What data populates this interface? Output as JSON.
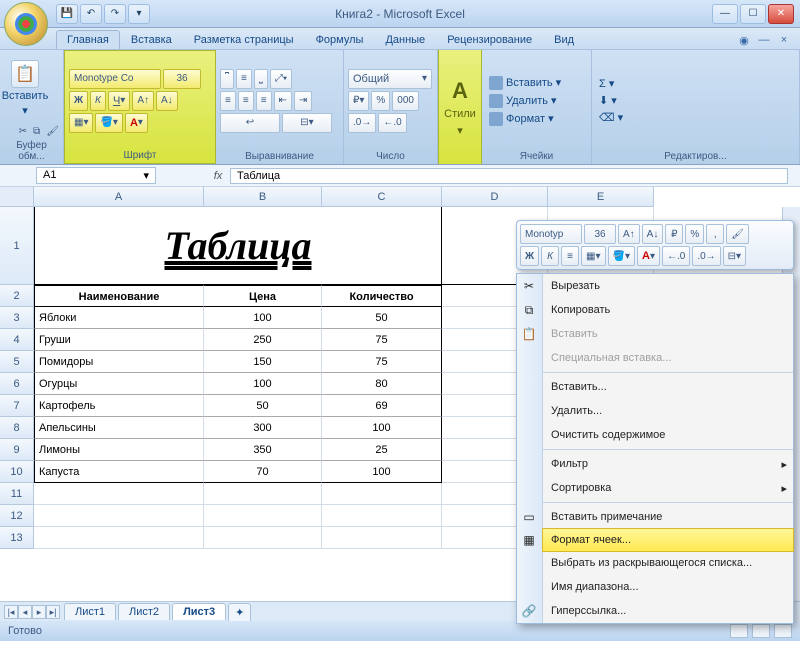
{
  "title": "Книга2 - Microsoft Excel",
  "qat": {
    "save": "💾",
    "undo": "↶",
    "redo": "↷"
  },
  "tabs": [
    "Главная",
    "Вставка",
    "Разметка страницы",
    "Формулы",
    "Данные",
    "Рецензирование",
    "Вид"
  ],
  "ribbon": {
    "paste": {
      "label": "Вставить"
    },
    "clipboard_label": "Буфер обм...",
    "font": {
      "family": "Monotype Co",
      "size": "36",
      "bold": "Ж",
      "italic": "К",
      "underline": "Ч",
      "label": "Шрифт"
    },
    "align_label": "Выравнивание",
    "number": {
      "format": "Общий",
      "label": "Число"
    },
    "styles_label": "Стили",
    "cells": {
      "insert": "Вставить",
      "delete": "Удалить",
      "format": "Формат",
      "label": "Ячейки"
    },
    "editing_label": "Редактиров..."
  },
  "namebox": "A1",
  "formula": "Таблица",
  "cols": [
    "A",
    "B",
    "C",
    "D",
    "E"
  ],
  "table": {
    "title": "Таблица",
    "headers": [
      "Наименование",
      "Цена",
      "Количество"
    ],
    "rows": [
      [
        "Яблоки",
        "100",
        "50"
      ],
      [
        "Груши",
        "250",
        "75"
      ],
      [
        "Помидоры",
        "150",
        "75"
      ],
      [
        "Огурцы",
        "100",
        "80"
      ],
      [
        "Картофель",
        "50",
        "69"
      ],
      [
        "Апельсины",
        "300",
        "100"
      ],
      [
        "Лимоны",
        "350",
        "25"
      ],
      [
        "Капуста",
        "70",
        "100"
      ]
    ]
  },
  "sheet_tabs": [
    "Лист1",
    "Лист2",
    "Лист3"
  ],
  "active_sheet": "Лист3",
  "status": "Готово",
  "minitool": {
    "font": "Monotyp",
    "size": "36",
    "bold": "Ж",
    "italic": "К"
  },
  "ctx": [
    {
      "label": "Вырезать",
      "ico": "✂"
    },
    {
      "label": "Копировать",
      "ico": "⧉"
    },
    {
      "label": "Вставить",
      "ico": "📋",
      "disabled": true
    },
    {
      "label": "Специальная вставка...",
      "disabled": true
    },
    {
      "sep": true
    },
    {
      "label": "Вставить..."
    },
    {
      "label": "Удалить..."
    },
    {
      "label": "Очистить содержимое"
    },
    {
      "sep": true
    },
    {
      "label": "Фильтр",
      "arrow": true
    },
    {
      "label": "Сортировка",
      "arrow": true
    },
    {
      "sep": true
    },
    {
      "label": "Вставить примечание",
      "ico": "▭"
    },
    {
      "label": "Формат ячеек...",
      "ico": "▦",
      "hl": true
    },
    {
      "label": "Выбрать из раскрывающегося списка..."
    },
    {
      "label": "Имя диапазона..."
    },
    {
      "label": "Гиперссылка...",
      "ico": "🔗"
    }
  ]
}
